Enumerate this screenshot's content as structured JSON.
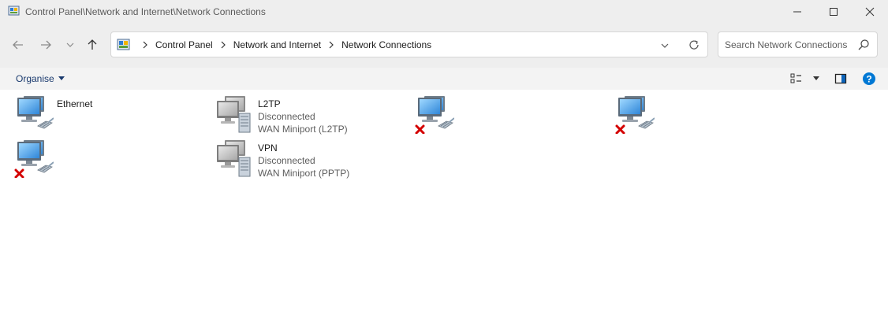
{
  "window": {
    "title": "Control Panel\\Network and Internet\\Network Connections"
  },
  "address": {
    "breadcrumb": [
      "Control Panel",
      "Network and Internet",
      "Network Connections"
    ]
  },
  "search": {
    "placeholder": "Search Network Connections"
  },
  "commandbar": {
    "organise_label": "Organise"
  },
  "connections": [
    {
      "name": "Ethernet",
      "status": "",
      "device": "",
      "icon": "ethernet-connected-icon"
    },
    {
      "name": "L2TP",
      "status": "Disconnected",
      "device": "WAN Miniport (L2TP)",
      "icon": "vpn-connection-icon"
    },
    {
      "name": "",
      "status": "",
      "device": "",
      "icon": "network-disconnected-icon"
    },
    {
      "name": "",
      "status": "",
      "device": "",
      "icon": "network-disconnected-icon"
    },
    {
      "name": "",
      "status": "",
      "device": "",
      "icon": "network-disconnected-icon"
    },
    {
      "name": "VPN",
      "status": "Disconnected",
      "device": "WAN Miniport (PPTP)",
      "icon": "vpn-connection-icon"
    }
  ],
  "colors": {
    "accent": "#1a3a6e",
    "help_blue": "#0078d4",
    "error_red": "#d40000"
  }
}
